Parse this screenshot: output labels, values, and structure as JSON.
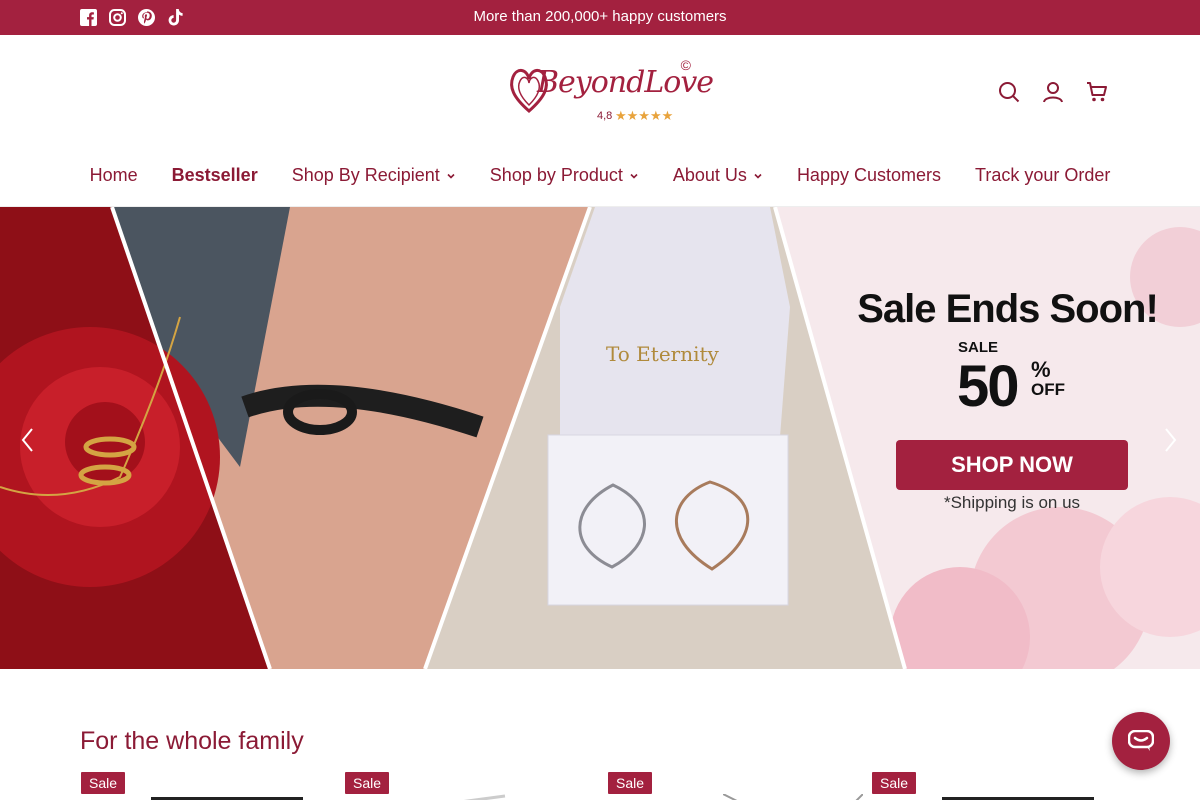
{
  "announcement": {
    "message": "More than 200,000+ happy customers",
    "socials": [
      "facebook-icon",
      "instagram-icon",
      "pinterest-icon",
      "tiktok-icon"
    ]
  },
  "header": {
    "logo": {
      "brand": "BeyondLove",
      "copyright": "©",
      "rating": "4,8",
      "stars": "★★★★★"
    },
    "icons": [
      "search-icon",
      "account-icon",
      "cart-icon"
    ]
  },
  "nav": {
    "items": [
      {
        "label": "Home",
        "dropdown": false,
        "bold": false
      },
      {
        "label": "Bestseller",
        "dropdown": false,
        "bold": true
      },
      {
        "label": "Shop By Recipient",
        "dropdown": true,
        "bold": false
      },
      {
        "label": "Shop by Product",
        "dropdown": true,
        "bold": false
      },
      {
        "label": "About Us",
        "dropdown": true,
        "bold": false
      },
      {
        "label": "Happy Customers",
        "dropdown": false,
        "bold": false
      },
      {
        "label": "Track your Order",
        "dropdown": false,
        "bold": false
      }
    ]
  },
  "hero": {
    "title": "Sale Ends Soon!",
    "sale_label": "SALE",
    "percent": "50",
    "percent_sign": "%",
    "off_label": "OFF",
    "cta": "SHOP NOW",
    "shipping_note": "*Shipping is on us",
    "box_text": "To Eternity"
  },
  "section": {
    "title": "For the whole family",
    "badges": [
      "Sale",
      "Sale",
      "Sale",
      "Sale"
    ]
  },
  "colors": {
    "brand": "#a3213f",
    "text": "#8b1a35",
    "stars": "#e8a33c"
  }
}
